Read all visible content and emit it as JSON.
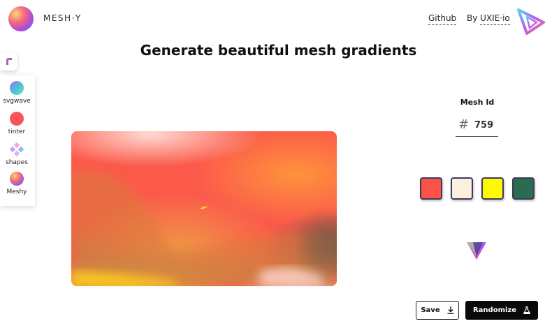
{
  "header": {
    "brand": "MESH·Y",
    "links": {
      "github": "Github",
      "by_prefix": "By ",
      "by_name": "UXIE·io"
    }
  },
  "headline": "Generate beautiful mesh gradients",
  "sidebar": {
    "items": [
      {
        "label": "svgwave",
        "icon": "svgwave-icon"
      },
      {
        "label": "tinter",
        "icon": "tinter-icon"
      },
      {
        "label": "shapes",
        "icon": "shapes-icon"
      },
      {
        "label": "Meshy",
        "icon": "meshy-icon"
      }
    ]
  },
  "mesh": {
    "label": "Mesh Id",
    "hash": "#",
    "id": "759"
  },
  "palette": {
    "colors": [
      "#fa5248",
      "#fcefde",
      "#fdf900",
      "#2b6b4f"
    ]
  },
  "actions": {
    "save": "Save",
    "randomize": "Randomize"
  }
}
